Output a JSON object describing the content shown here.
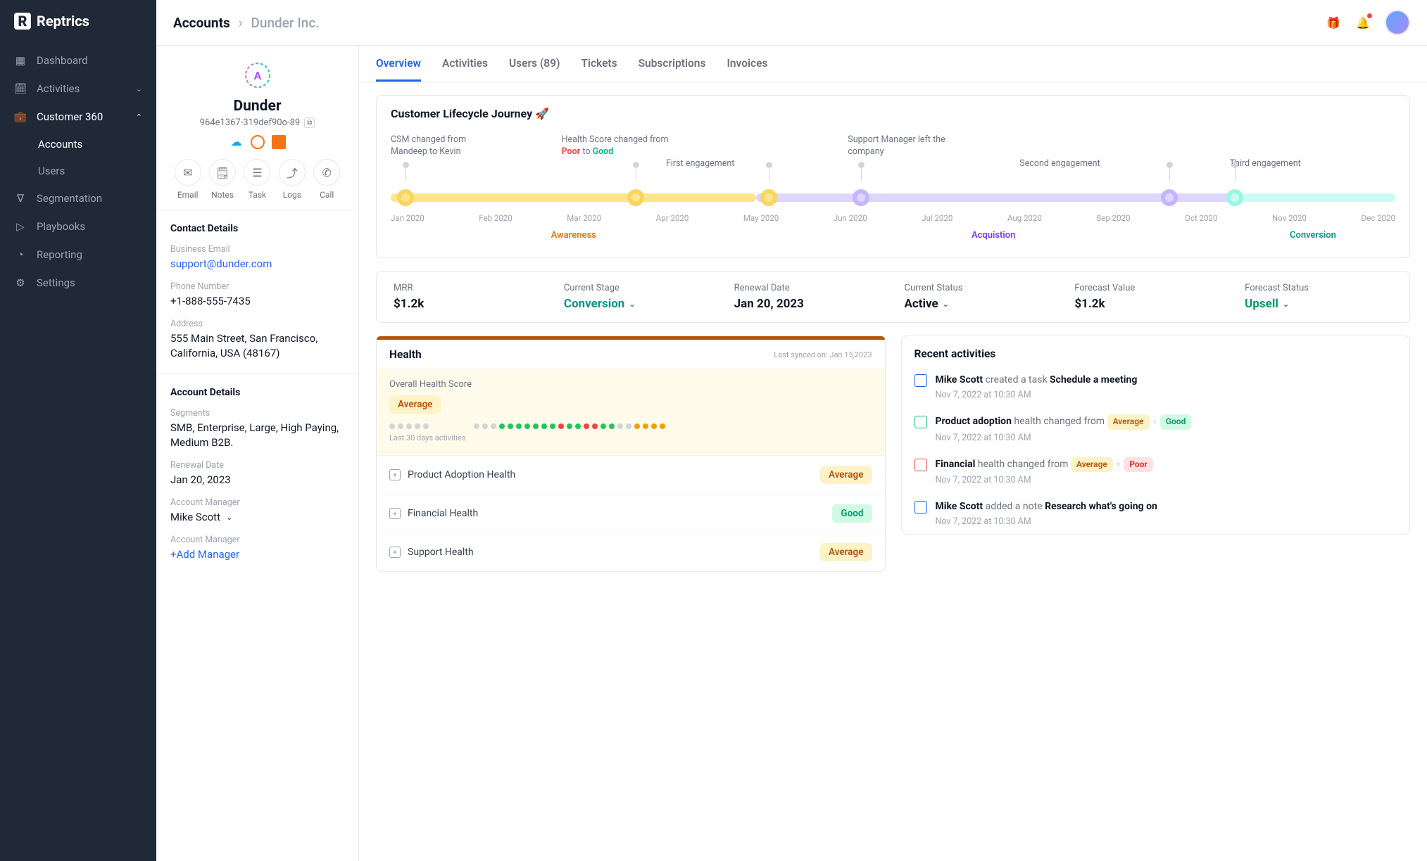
{
  "brand": "Reptrics",
  "nav": {
    "dashboard": "Dashboard",
    "activities": "Activities",
    "customer360": "Customer 360",
    "accounts": "Accounts",
    "users": "Users",
    "segmentation": "Segmentation",
    "playbooks": "Playbooks",
    "reporting": "Reporting",
    "settings": "Settings"
  },
  "breadcrumb": {
    "root": "Accounts",
    "current": "Dunder Inc."
  },
  "account": {
    "name": "Dunder",
    "id": "964e1367-319def90o-89",
    "actions": {
      "email": "Email",
      "notes": "Notes",
      "task": "Task",
      "logs": "Logs",
      "call": "Call"
    }
  },
  "contact": {
    "title": "Contact Details",
    "emailLabel": "Business Email",
    "email": "support@dunder.com",
    "phoneLabel": "Phone Number",
    "phone": "+1-888-555-7435",
    "addressLabel": "Address",
    "address": "555 Main Street, San Francisco, California, USA (48167)"
  },
  "accountDetails": {
    "title": "Account Details",
    "segmentsLabel": "Segments",
    "segments": "SMB, Enterprise, Large, High Paying, Medium B2B.",
    "renewalLabel": "Renewal Date",
    "renewal": "Jan 20, 2023",
    "mgrLabel": "Account Manager",
    "mgr": "Mike Scott",
    "addMgrLabel": "Account Manager",
    "addMgr": "+Add Manager"
  },
  "tabs": {
    "overview": "Overview",
    "activities": "Activities",
    "users": "Users (89)",
    "tickets": "Tickets",
    "subscriptions": "Subscriptions",
    "invoices": "Invoices"
  },
  "journey": {
    "title": "Customer Lifecycle Journey 🚀",
    "months": [
      "Jan 2020",
      "Feb 2020",
      "Mar 2020",
      "Apr 2020",
      "May 2020",
      "Jun 2020",
      "Jul 2020",
      "Aug 2020",
      "Sep 2020",
      "Oct 2020",
      "Nov 2020",
      "Dec 2020"
    ],
    "phases": {
      "awareness": "Awareness",
      "acquisition": "Acquistion",
      "conversion": "Conversion"
    },
    "anno": {
      "csm": "CSM changed from Mandeep to Kevin",
      "hsPre": "Health Score changed from ",
      "hsPoor": "Poor",
      "hsMid": " to ",
      "hsGood": "Good",
      "first": "First engagement",
      "support": "Support Manager left the company",
      "second": "Second engagement",
      "third": "Third engagement"
    }
  },
  "kpi": {
    "mrrLabel": "MRR",
    "mrr": "$1.2k",
    "stageLabel": "Current Stage",
    "stage": "Conversion",
    "renewLabel": "Renewal Date",
    "renew": "Jan 20, 2023",
    "statusLabel": "Current Status",
    "status": "Active",
    "forecastLabel": "Forecast Value",
    "forecast": "$1.2k",
    "fstatusLabel": "Forecast Status",
    "fstatus": "Upsell"
  },
  "health": {
    "title": "Health",
    "sync": "Last synced on: Jan 15,2023",
    "ohsLabel": "Overall Health Score",
    "ohs": "Average",
    "dotsLabel": "Last 30 days activities",
    "items": [
      {
        "name": "Product Adoption Health",
        "badge": "Average",
        "cls": "avg"
      },
      {
        "name": "Financial Health",
        "badge": "Good",
        "cls": "good"
      },
      {
        "name": "Support Health",
        "badge": "Average",
        "cls": "avg"
      }
    ]
  },
  "recent": {
    "title": "Recent activities",
    "items": [
      {
        "who": "Mike Scott",
        "mid": " created a task ",
        "what": "Schedule a meeting",
        "time": "Nov 7, 2022 at 10:30 AM"
      },
      {
        "who": "Product adoption",
        "mid": " health changed from ",
        "b1": "Average",
        "b1c": "avg",
        "b2": "Good",
        "b2c": "good",
        "time": "Nov 7, 2022 at 10:30 AM"
      },
      {
        "who": "Financial",
        "mid": " health changed from ",
        "b1": "Average",
        "b1c": "avg",
        "b2": "Poor",
        "b2c": "poor",
        "time": "Nov 7, 2022 at 10:30 AM"
      },
      {
        "who": "Mike Scott",
        "mid": " added a note ",
        "what": "Research what's going on",
        "time": "Nov 7, 2022 at 10:30 AM"
      }
    ]
  },
  "chart_data": {
    "type": "timeline",
    "x_labels": [
      "Jan 2020",
      "Feb 2020",
      "Mar 2020",
      "Apr 2020",
      "May 2020",
      "Jun 2020",
      "Jul 2020",
      "Aug 2020",
      "Sep 2020",
      "Oct 2020",
      "Nov 2020",
      "Dec 2020"
    ],
    "phases": [
      {
        "name": "Awareness",
        "start": "Jan 2020",
        "end": "May 2020",
        "color": "#fde68a"
      },
      {
        "name": "Acquistion",
        "start": "May 2020",
        "end": "Nov 2020",
        "color": "#c4b5fd"
      },
      {
        "name": "Conversion",
        "start": "Nov 2020",
        "end": "Dec 2020",
        "color": "#99f6e4"
      }
    ],
    "events": [
      {
        "label": "CSM changed from Mandeep to Kevin",
        "month": "Jan 2020"
      },
      {
        "label": "Health Score changed from Poor to Good",
        "month": "Apr 2020"
      },
      {
        "label": "First engagement",
        "month": "May 2020"
      },
      {
        "label": "Support Manager left the company",
        "month": "Jun 2020"
      },
      {
        "label": "Second engagement",
        "month": "Oct 2020"
      },
      {
        "label": "Third engagement",
        "month": "Nov 2020"
      }
    ]
  }
}
